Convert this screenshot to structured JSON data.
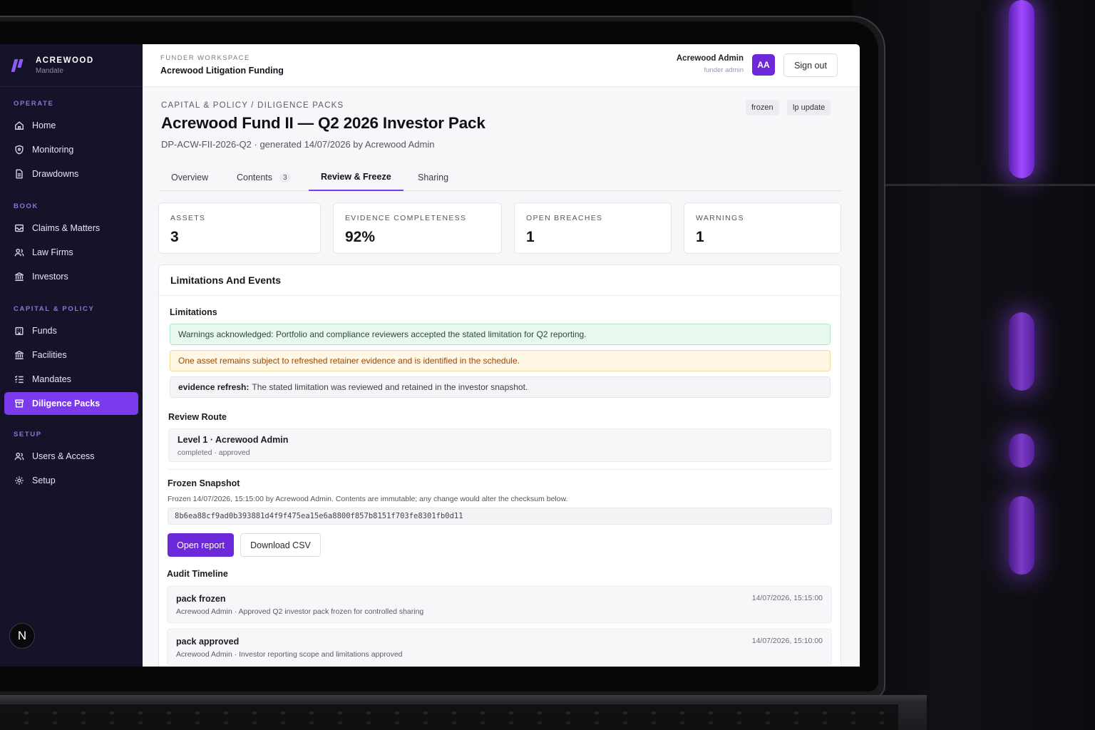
{
  "brand": {
    "name": "ACREWOOD",
    "sub": "Mandate"
  },
  "sidebar": {
    "sections": [
      {
        "label": "OPERATE",
        "items": [
          {
            "label": "Home",
            "icon": "home-icon"
          },
          {
            "label": "Monitoring",
            "icon": "shield-icon"
          },
          {
            "label": "Drawdowns",
            "icon": "document-icon"
          }
        ]
      },
      {
        "label": "BOOK",
        "items": [
          {
            "label": "Claims & Matters",
            "icon": "inbox-icon"
          },
          {
            "label": "Law Firms",
            "icon": "users-icon"
          },
          {
            "label": "Investors",
            "icon": "bank-icon"
          }
        ]
      },
      {
        "label": "CAPITAL & POLICY",
        "items": [
          {
            "label": "Funds",
            "icon": "building-icon"
          },
          {
            "label": "Facilities",
            "icon": "bank-icon"
          },
          {
            "label": "Mandates",
            "icon": "checklist-icon"
          },
          {
            "label": "Diligence Packs",
            "icon": "package-icon",
            "active": true
          }
        ]
      },
      {
        "label": "SETUP",
        "items": [
          {
            "label": "Users & Access",
            "icon": "users-icon"
          },
          {
            "label": "Setup",
            "icon": "gear-icon"
          }
        ]
      }
    ],
    "footer_badge": "N"
  },
  "topbar": {
    "workspace_label": "FUNDER WORKSPACE",
    "workspace_name": "Acrewood Litigation Funding",
    "user_name": "Acrewood Admin",
    "user_role": "funder admin",
    "avatar_initials": "AA",
    "sign_out": "Sign out"
  },
  "page": {
    "breadcrumb": "CAPITAL & POLICY / DILIGENCE PACKS",
    "title": "Acrewood Fund II — Q2 2026 Investor Pack",
    "meta": "DP-ACW-FII-2026-Q2 · generated 14/07/2026 by Acrewood Admin",
    "tags": [
      "frozen",
      "lp update"
    ]
  },
  "tabs": [
    {
      "label": "Overview"
    },
    {
      "label": "Contents",
      "count": "3"
    },
    {
      "label": "Review & Freeze",
      "active": true
    },
    {
      "label": "Sharing"
    }
  ],
  "kpis": [
    {
      "label": "ASSETS",
      "value": "3"
    },
    {
      "label": "EVIDENCE COMPLETENESS",
      "value": "92%"
    },
    {
      "label": "OPEN BREACHES",
      "value": "1"
    },
    {
      "label": "WARNINGS",
      "value": "1"
    }
  ],
  "panel": {
    "title": "Limitations And Events",
    "limitations_heading": "Limitations",
    "limitations": {
      "green": "Warnings acknowledged: Portfolio and compliance reviewers accepted the stated limitation for Q2 reporting.",
      "amber": "One asset remains subject to refreshed retainer evidence and is identified in the schedule.",
      "grey_label": "evidence refresh:",
      "grey_text": "The stated limitation was reviewed and retained in the investor snapshot."
    },
    "review_heading": "Review Route",
    "review": {
      "title": "Level 1 · Acrewood Admin",
      "status": "completed · approved"
    },
    "frozen_heading": "Frozen Snapshot",
    "frozen_text": "Frozen 14/07/2026, 15:15:00 by Acrewood Admin. Contents are immutable; any change would alter the checksum below.",
    "checksum": "8b6ea88cf9ad0b393881d4f9f475ea15e6a8800f857b8151f703fe8301fb0d11",
    "open_report": "Open report",
    "download_csv": "Download CSV",
    "audit_heading": "Audit Timeline",
    "events": [
      {
        "title": "pack frozen",
        "detail": "Acrewood Admin · Approved Q2 investor pack frozen for controlled sharing",
        "time": "14/07/2026, 15:15:00"
      },
      {
        "title": "pack approved",
        "detail": "Acrewood Admin · Investor reporting scope and limitations approved",
        "time": "14/07/2026, 15:10:00"
      }
    ]
  },
  "colors": {
    "accent": "#7c3aed",
    "sidebar_bg": "#15132a",
    "primary_button": "#6d28d9"
  }
}
